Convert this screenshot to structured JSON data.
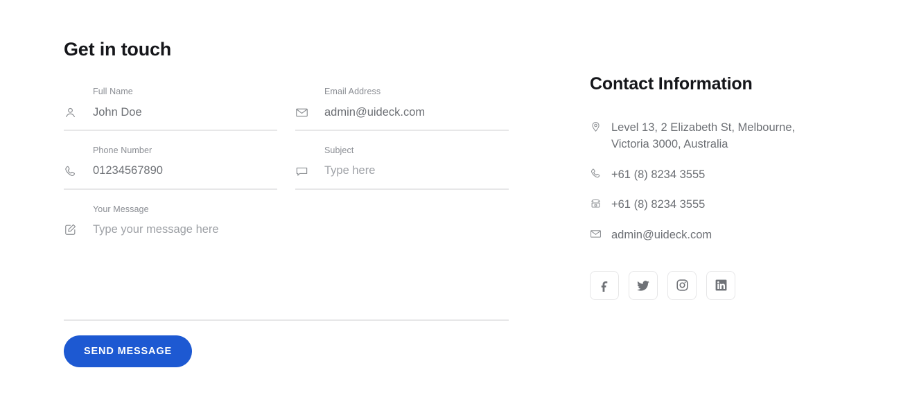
{
  "form": {
    "title": "Get in touch",
    "fields": [
      {
        "label": "Full Name",
        "value": "John Doe",
        "is_placeholder": false,
        "icon": "user-icon"
      },
      {
        "label": "Email Address",
        "value": "admin@uideck.com",
        "is_placeholder": false,
        "icon": "envelope-icon"
      },
      {
        "label": "Phone Number",
        "value": "01234567890",
        "is_placeholder": false,
        "icon": "phone-icon"
      },
      {
        "label": "Subject",
        "value": "Type here",
        "is_placeholder": true,
        "icon": "chat-bubble-icon"
      },
      {
        "label": "Your Message",
        "value": "Type your message here",
        "is_placeholder": true,
        "icon": "pencil-square-icon"
      }
    ],
    "submit_label": "SEND MESSAGE",
    "submit_color": "#1d59d2"
  },
  "contact": {
    "title": "Contact Information",
    "items": [
      {
        "icon": "map-pin-icon",
        "text": "Level 13, 2 Elizabeth St, Melbourne, Victoria 3000, Australia"
      },
      {
        "icon": "phone-icon",
        "text": "+61 (8) 8234 3555"
      },
      {
        "icon": "fax-icon",
        "text": "+61 (8) 8234 3555"
      },
      {
        "icon": "envelope-icon",
        "text": "admin@uideck.com"
      }
    ],
    "socials": [
      {
        "name": "facebook",
        "label": "Facebook"
      },
      {
        "name": "twitter",
        "label": "Twitter"
      },
      {
        "name": "instagram",
        "label": "Instagram"
      },
      {
        "name": "linkedin",
        "label": "LinkedIn"
      }
    ]
  }
}
